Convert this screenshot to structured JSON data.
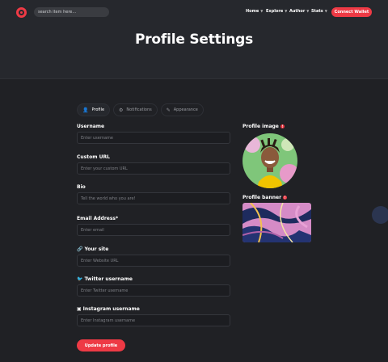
{
  "header": {
    "search_placeholder": "search item here...",
    "nav": [
      {
        "label": "Home"
      },
      {
        "label": "Explore"
      },
      {
        "label": "Author"
      },
      {
        "label": "Stats"
      }
    ],
    "connect_label": "Connect Wallet",
    "page_title": "Profile Settings",
    "accent": "#ee3a45"
  },
  "tabs": [
    {
      "label": "Profile",
      "icon": "user-icon",
      "active": true
    },
    {
      "label": "Notifications",
      "icon": "gear-icon",
      "active": false
    },
    {
      "label": "Appearance",
      "icon": "pencil-icon",
      "active": false
    }
  ],
  "form": {
    "username": {
      "label": "Username",
      "placeholder": "Enter username"
    },
    "custom_url": {
      "label": "Custom URL",
      "placeholder": "Enter your custom URL"
    },
    "bio": {
      "label": "Bio",
      "placeholder": "Tell the world who you are!"
    },
    "email": {
      "label": "Email Address*",
      "placeholder": "Enter email"
    },
    "site": {
      "label": "Your site",
      "icon": "link-icon",
      "placeholder": "Enter Website URL"
    },
    "twitter": {
      "label": "Twitter username",
      "icon": "twitter-icon",
      "placeholder": "Enter Twitter username"
    },
    "instagram": {
      "label": "Instagram username",
      "icon": "instagram-icon",
      "placeholder": "Enter Instagram username"
    },
    "update_label": "Update profile"
  },
  "media": {
    "profile_image_label": "Profile image",
    "profile_banner_label": "Profile banner"
  }
}
